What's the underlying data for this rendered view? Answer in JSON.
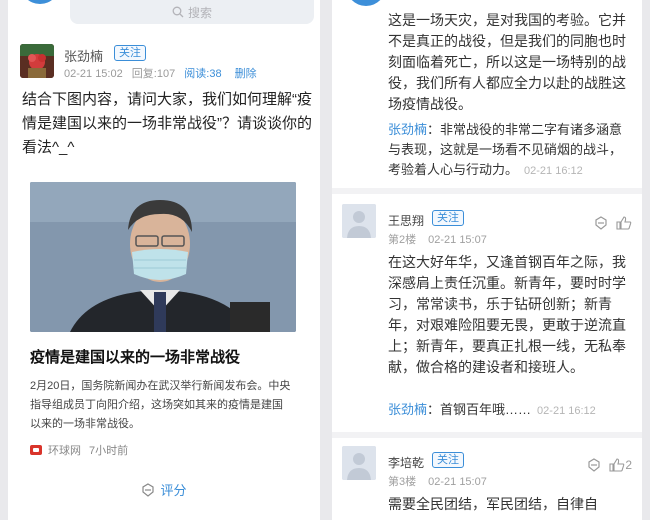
{
  "left": {
    "search_placeholder": "搜索",
    "post": {
      "author": "张劲楠",
      "follow_label": "关注",
      "datetime": "02-21 15:02",
      "reply_count": "回复:107",
      "read_count": "阅读:38",
      "delete_label": "删除",
      "body": "结合下图内容，请问大家，我们如何理解“疫情是建国以来的一场非常战役”？请谈谈你的看法^_^"
    },
    "card": {
      "title": "疫情是建国以来的一场非常战役",
      "description": "2月20日，国务院新闻办在武汉举行新闻发布会。中央指导组成员丁向阳介绍，这场突如其来的疫情是建国以来的一场非常战役。",
      "source": "环球网",
      "time": "7小时前"
    },
    "rate_label": "评分"
  },
  "right": {
    "first_comment_text": "这是一场天灾，是对我国的考验。它并不是真正的战役，但是我们的同胞也时刻面临着死亡，所以这是一场特别的战役，我们所有人都应全力以赴的战胜这场疫情战役。",
    "first_reply": {
      "name": "张劲楠",
      "text": "非常战役的非常二字有诸多涵意与表现，这就是一场看不见硝烟的战斗，考验着人心与行动力。",
      "time": "02-21 16:12"
    },
    "comments": [
      {
        "name": "王思翔",
        "follow_label": "关注",
        "floor": "第2楼",
        "time": "02-21 15:07",
        "like_count": "",
        "text": "在这大好年华，又逢首钢百年之际，我深感肩上责任沉重。新青年，要时时学习，常常读书，乐于钻研创新；新青年，对艰难险阻要无畏，更敢于逆流直上；新青年，要真正扎根一线，无私奉献，做合格的建设者和接班人。",
        "reply": {
          "name": "张劲楠",
          "text": "首钢百年哦……",
          "time": "02-21 16:12"
        }
      },
      {
        "name": "李培乾",
        "follow_label": "关注",
        "floor": "第3楼",
        "time": "02-21 15:07",
        "like_count": "2",
        "text": "需要全民团结，军民团结，自律自"
      }
    ]
  }
}
